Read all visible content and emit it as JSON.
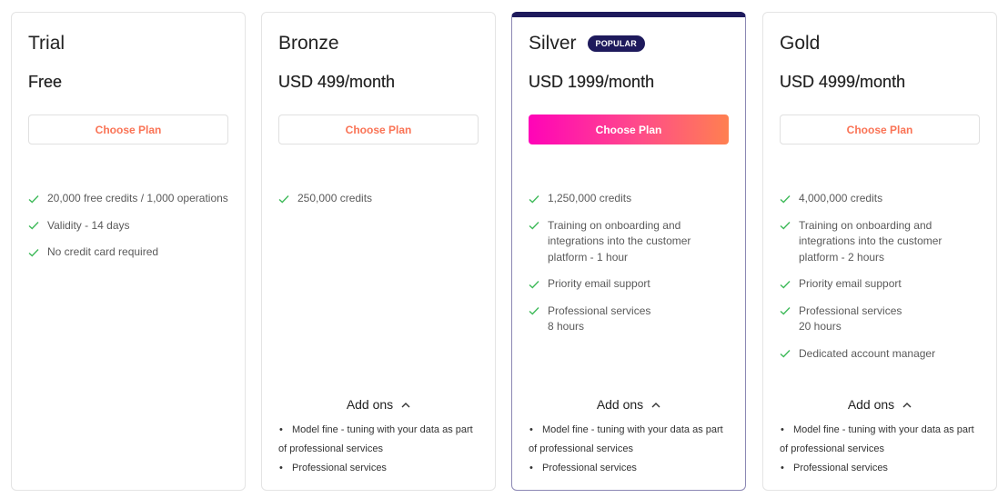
{
  "colors": {
    "accent_text": "#fa7355",
    "popular_navy": "#1e1a5c",
    "check_green": "#3fba5a",
    "gradient_start": "#ff03b8",
    "gradient_end": "#ff8050"
  },
  "plans": [
    {
      "name": "Trial",
      "price": "Free",
      "button_label": "Choose Plan",
      "features": [
        "20,000 free credits / 1,000 operations",
        "Validity - 14 days",
        "No credit card required"
      ]
    },
    {
      "name": "Bronze",
      "price": "USD 499/month",
      "button_label": "Choose Plan",
      "features": [
        "250,000 credits"
      ],
      "addons_label": "Add ons",
      "addons": [
        "Model fine - tuning with your data as part of professional services",
        "Professional services"
      ]
    },
    {
      "name": "Silver",
      "badge": "POPULAR",
      "price": "USD 1999/month",
      "button_label": "Choose Plan",
      "features": [
        "1,250,000 credits",
        "Training on onboarding and integrations into the customer platform - 1 hour",
        "Priority email support",
        "Professional services\n8 hours"
      ],
      "addons_label": "Add ons",
      "addons": [
        "Model fine - tuning with your data as part of professional services",
        "Professional services"
      ]
    },
    {
      "name": "Gold",
      "price": "USD 4999/month",
      "button_label": "Choose Plan",
      "features": [
        "4,000,000 credits",
        "Training on onboarding and integrations into the customer platform - 2 hours",
        "Priority email support",
        "Professional services\n20 hours",
        "Dedicated account manager"
      ],
      "addons_label": "Add ons",
      "addons": [
        "Model fine - tuning with your data as part of professional services",
        "Professional services"
      ]
    }
  ]
}
